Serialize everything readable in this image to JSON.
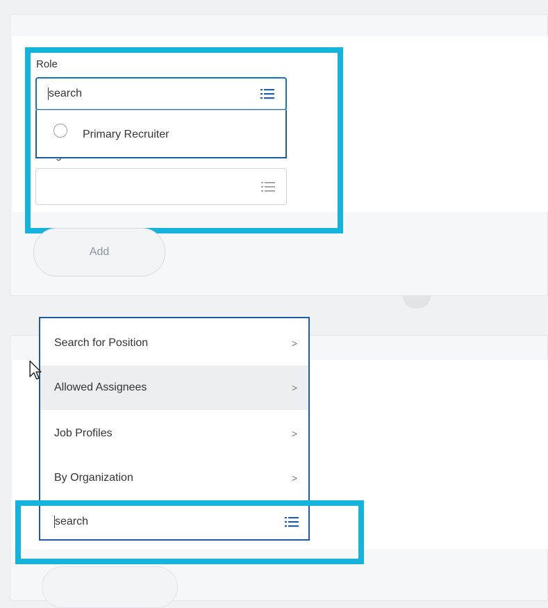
{
  "top_form": {
    "role_label": "Role",
    "role_search_value": "search",
    "role_option": "Primary Recruiter",
    "assigned_to_label": "Assigned To",
    "assigned_to_required": "*",
    "assigned_to_value": ""
  },
  "add_button": {
    "label": "Add"
  },
  "prompt_menu": {
    "items": [
      {
        "label": "Search for Position",
        "chevron": ">"
      },
      {
        "label": "Allowed Assignees",
        "chevron": ">"
      },
      {
        "label": "Job Profiles",
        "chevron": ">"
      },
      {
        "label": "By Organization",
        "chevron": ">"
      }
    ],
    "search_value": "search"
  },
  "colors": {
    "highlight": "#16b3dd",
    "focus_border": "#1b6ec2",
    "icon_blue": "#1f5fa8",
    "icon_gray": "#8b9299",
    "required": "#e34b2d"
  },
  "icons": [
    "list-icon",
    "radio-icon",
    "chevron-right-icon",
    "mouse-cursor-icon"
  ]
}
